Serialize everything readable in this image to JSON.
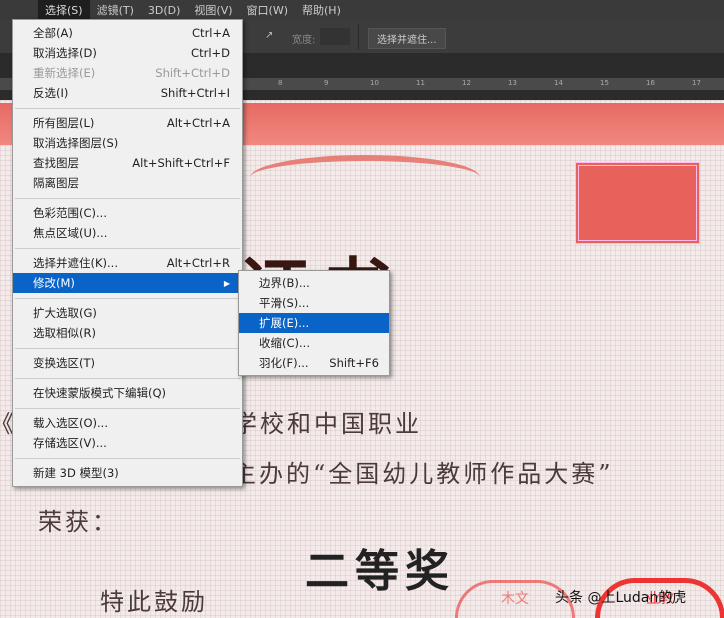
{
  "menubar": {
    "items": [
      "选择(S)",
      "滤镜(T)",
      "3D(D)",
      "视图(V)",
      "窗口(W)",
      "帮助(H)"
    ]
  },
  "options": {
    "width_label": "宽度:",
    "select_mask_button": "选择并遮住..."
  },
  "ruler": [
    "8",
    "9",
    "10",
    "11",
    "12",
    "13",
    "14",
    "15",
    "16",
    "17"
  ],
  "select_menu": {
    "groups": [
      [
        {
          "label": "全部(A)",
          "shortcut": "Ctrl+A"
        },
        {
          "label": "取消选择(D)",
          "shortcut": "Ctrl+D"
        },
        {
          "label": "重新选择(E)",
          "shortcut": "Shift+Ctrl+D",
          "disabled": true
        },
        {
          "label": "反选(I)",
          "shortcut": "Shift+Ctrl+I"
        }
      ],
      [
        {
          "label": "所有图层(L)",
          "shortcut": "Alt+Ctrl+A"
        },
        {
          "label": "取消选择图层(S)",
          "shortcut": ""
        },
        {
          "label": "查找图层",
          "shortcut": "Alt+Shift+Ctrl+F"
        },
        {
          "label": "隔离图层",
          "shortcut": ""
        }
      ],
      [
        {
          "label": "色彩范围(C)...",
          "shortcut": ""
        },
        {
          "label": "焦点区域(U)...",
          "shortcut": ""
        }
      ],
      [
        {
          "label": "选择并遮住(K)...",
          "shortcut": "Alt+Ctrl+R"
        },
        {
          "label": "修改(M)",
          "shortcut": "",
          "submenu": true,
          "highlighted": true
        }
      ],
      [
        {
          "label": "扩大选取(G)",
          "shortcut": ""
        },
        {
          "label": "选取相似(R)",
          "shortcut": ""
        }
      ],
      [
        {
          "label": "变换选区(T)",
          "shortcut": ""
        }
      ],
      [
        {
          "label": "在快速蒙版模式下编辑(Q)",
          "shortcut": ""
        }
      ],
      [
        {
          "label": "载入选区(O)...",
          "shortcut": ""
        },
        {
          "label": "存储选区(V)...",
          "shortcut": ""
        }
      ],
      [
        {
          "label": "新建 3D 模型(3)",
          "shortcut": ""
        }
      ]
    ]
  },
  "modify_submenu": [
    {
      "label": "边界(B)...",
      "shortcut": ""
    },
    {
      "label": "平滑(S)...",
      "shortcut": ""
    },
    {
      "label": "扩展(E)...",
      "shortcut": "",
      "highlighted": true
    },
    {
      "label": "收缩(C)...",
      "shortcut": ""
    },
    {
      "label": "羽化(F)...",
      "shortcut": "Shift+F6"
    }
  ],
  "certificate": {
    "title": "荣誉证书",
    "line1": "《居士》在端木幼师学校和中国职业",
    "line2": "合主办的“全国幼儿教师作品大赛”",
    "award_label": "荣获：",
    "prize": "二等奖",
    "closing": "特此鼓励",
    "stamp_left": "木文",
    "stamp_right": "业教"
  },
  "watermark": "头条 @上Ludan的虎",
  "colors": {
    "highlight": "#0a64c8",
    "certificate_red": "#e76a64"
  }
}
